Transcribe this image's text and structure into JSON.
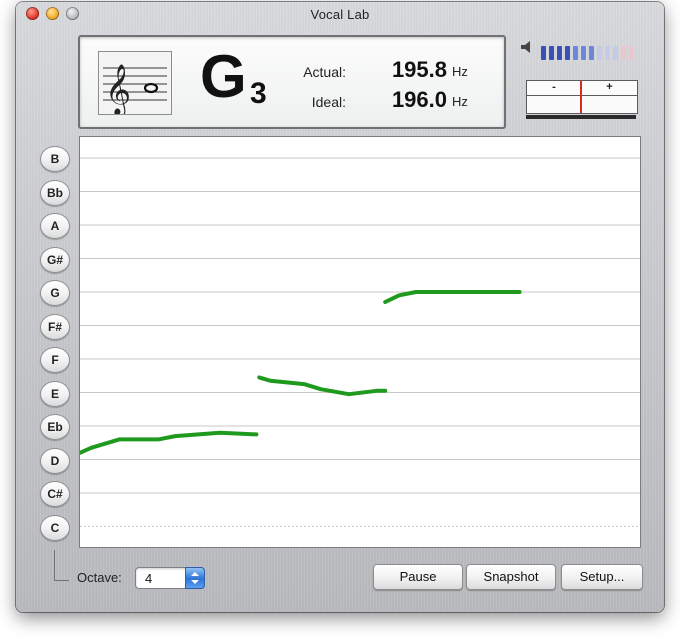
{
  "window": {
    "title": "Vocal Lab"
  },
  "display": {
    "note": "G",
    "octave": "3",
    "actual_label": "Actual:",
    "actual_value": "195.8",
    "ideal_label": "Ideal:",
    "ideal_value": "196.0",
    "unit": "Hz"
  },
  "tuner": {
    "minus": "-",
    "plus": "+",
    "offset_fraction": -0.02
  },
  "volume": {
    "bars": 12,
    "active": 7
  },
  "notes": [
    "B",
    "Bb",
    "A",
    "G#",
    "G",
    "F#",
    "F",
    "E",
    "Eb",
    "D",
    "C#",
    "C"
  ],
  "controls": {
    "octave_label": "Octave:",
    "octave_value": "4",
    "pause_label": "Pause",
    "snapshot_label": "Snapshot",
    "setup_label": "Setup..."
  },
  "colors": {
    "pitch_trace": "#1f9a1f",
    "grid": "#c8c8c8",
    "needle": "#d62b1e"
  },
  "pitch_trace": [
    {
      "segment": 1,
      "points": [
        [
          0.0,
          2.2
        ],
        [
          0.02,
          2.35
        ],
        [
          0.07,
          2.6
        ],
        [
          0.14,
          2.6
        ],
        [
          0.17,
          2.7
        ],
        [
          0.25,
          2.8
        ],
        [
          0.315,
          2.75
        ]
      ]
    },
    {
      "segment": 2,
      "points": [
        [
          0.32,
          4.45
        ],
        [
          0.34,
          4.35
        ],
        [
          0.4,
          4.25
        ],
        [
          0.43,
          4.1
        ],
        [
          0.48,
          3.95
        ],
        [
          0.53,
          4.05
        ],
        [
          0.545,
          4.05
        ]
      ]
    },
    {
      "segment": 3,
      "points": [
        [
          0.545,
          6.7
        ],
        [
          0.57,
          6.9
        ],
        [
          0.6,
          7.0
        ],
        [
          0.7,
          7.0
        ],
        [
          0.785,
          7.0
        ]
      ]
    }
  ]
}
